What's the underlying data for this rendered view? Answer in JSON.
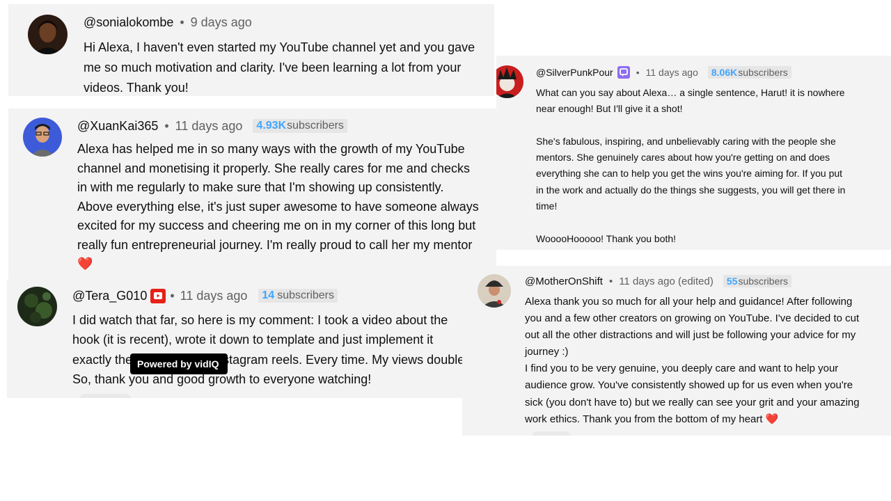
{
  "comments": [
    {
      "handle": "@sonialokombe",
      "time": "9 days ago",
      "lines": [
        "Hi Alexa, I haven't even started my YouTube channel yet and you gave",
        "me so much motivation and clarity. I've been learning a lot from your",
        "videos. Thank you!"
      ]
    },
    {
      "handle": "@XuanKai365",
      "time": "11 days ago",
      "subs_count": "4.93K",
      "subs_label": "subscribers",
      "lines": [
        "Alexa has helped me in so many ways with the growth of my YouTube",
        "channel and monetising it properly. She really cares for me and checks",
        "in with me regularly to make sure that I'm showing up consistently.",
        "Above everything else, it's just super awesome to have someone always",
        "excited for my success and cheering me on in my corner of this long but",
        "really fun entrepreneurial journey. I'm really proud to call her my mentor"
      ],
      "emoji": "❤️"
    },
    {
      "handle": "@Tera_G010",
      "time": "11 days ago",
      "subs_count": "14",
      "subs_label": "subscribers",
      "lines": [
        "I did watch that far, so here is my comment: I took a video about the",
        "hook (it is recent), wrote it down to template and just implement it",
        "exactly the same way on instagram reels. Every time. My views doubled",
        "So, thank you and good growth to everyone watching!"
      ]
    },
    {
      "handle": "@SilverPunkPour",
      "time": "11 days ago",
      "subs_count": "8.06K",
      "subs_label": "subscribers",
      "lines": [
        "What can you say about Alexa… a single sentence, Harut! it is nowhere",
        "near enough! But I'll give it a shot!",
        "",
        "She's fabulous, inspiring, and unbelievably caring with the people she",
        "mentors. She genuinely cares about how you're getting on and does",
        "everything she can to help you get the wins you're aiming for. If you put",
        "in the work and actually do the things she suggests, you will get there in",
        "time!",
        "",
        "WooooHooooo! Thank you both!"
      ]
    },
    {
      "handle": "@MotherOnShift",
      "time": "11 days ago (edited)",
      "subs_count": "55",
      "subs_label": "subscribers",
      "lines": [
        "Alexa thank you so much for all your help and guidance! After following",
        "you and a few other creators on growing on YouTube. I've decided to cut",
        "out all the other distractions and will just be following your advice for my",
        "journey :)",
        "I find you to be very genuine, you deeply care and want to help your",
        "audience grow.  You've consistently showed up for us even when you're",
        "sick (you don't have to) but we really can see your grit and your amazing",
        "work ethics. Thank you from the bottom of my heart"
      ],
      "emoji": "❤️"
    }
  ],
  "meta_separator": "•",
  "tooltip": "Powered by vidIQ",
  "colors": {
    "card_bg": "#f3f3f3",
    "subs_accent": "#3ea6ff",
    "heart": "#e53935",
    "badge_purple": "#8e6cf0",
    "badge_red": "#e62117"
  },
  "icons": {
    "silverpunk_badge": "purple-channel-icon",
    "tera_badge": "red-youtube-icon"
  }
}
